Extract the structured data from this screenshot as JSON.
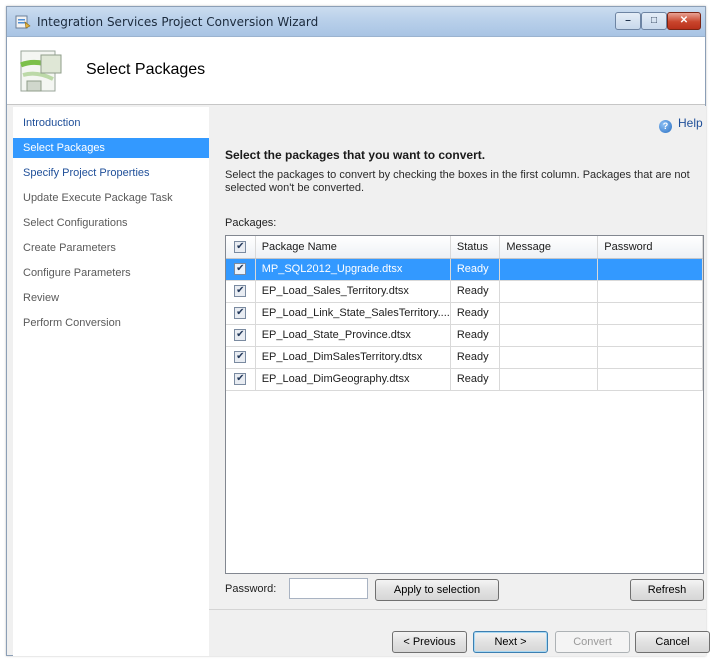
{
  "window": {
    "title": "Integration Services Project Conversion Wizard",
    "controls": {
      "minimize": "–",
      "maximize": "□",
      "close": "✕"
    }
  },
  "header": {
    "title": "Select Packages",
    "icon": "wizard-package-icon"
  },
  "nav": {
    "items": [
      {
        "label": "Introduction",
        "state": "link"
      },
      {
        "label": "Select Packages",
        "state": "selected"
      },
      {
        "label": "Specify Project Properties",
        "state": "link"
      },
      {
        "label": "Update Execute Package Task",
        "state": "inactive"
      },
      {
        "label": "Select Configurations",
        "state": "inactive"
      },
      {
        "label": "Create Parameters",
        "state": "inactive"
      },
      {
        "label": "Configure Parameters",
        "state": "inactive"
      },
      {
        "label": "Review",
        "state": "inactive"
      },
      {
        "label": "Perform Conversion",
        "state": "inactive"
      }
    ]
  },
  "content": {
    "help": "Help",
    "heading": "Select the packages that you want to convert.",
    "description": "Select the packages to convert by checking the boxes in the first column. Packages that are not selected won't be converted.",
    "packages_label": "Packages:",
    "columns": {
      "check": "✔",
      "name": "Package Name",
      "status": "Status",
      "message": "Message",
      "password": "Password"
    },
    "rows": [
      {
        "checked": "✔",
        "name": "MP_SQL2012_Upgrade.dtsx",
        "status": "Ready",
        "message": "",
        "password": ""
      },
      {
        "checked": "✔",
        "name": "EP_Load_Sales_Territory.dtsx",
        "status": "Ready",
        "message": "",
        "password": ""
      },
      {
        "checked": "✔",
        "name": "EP_Load_Link_State_SalesTerritory....",
        "status": "Ready",
        "message": "",
        "password": ""
      },
      {
        "checked": "✔",
        "name": "EP_Load_State_Province.dtsx",
        "status": "Ready",
        "message": "",
        "password": ""
      },
      {
        "checked": "✔",
        "name": "EP_Load_DimSalesTerritory.dtsx",
        "status": "Ready",
        "message": "",
        "password": ""
      },
      {
        "checked": "✔",
        "name": "EP_Load_DimGeography.dtsx",
        "status": "Ready",
        "message": "",
        "password": ""
      }
    ],
    "password_label": "Password:",
    "password_value": "",
    "apply_button": "Apply to selection",
    "refresh_button": "Refresh"
  },
  "footer": {
    "previous": "< Previous",
    "next": "Next >",
    "convert": "Convert",
    "cancel": "Cancel"
  },
  "colors": {
    "selection": "#3399ff",
    "link": "#1f4f99"
  }
}
